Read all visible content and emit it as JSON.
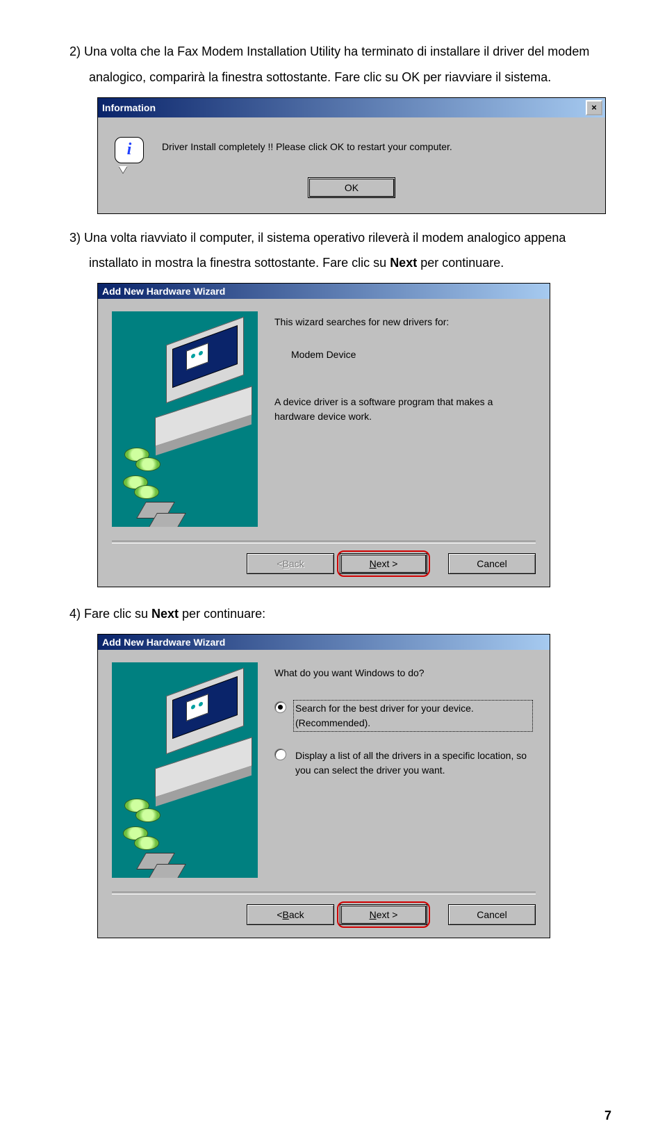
{
  "para2_line1": "2) Una volta che la Fax Modem Installation Utility ha terminato di installare il driver del modem",
  "para2_line2": "analogico, comparirà la finestra sottostante. Fare clic su OK per riavviare il sistema.",
  "info_dialog": {
    "title": "Information",
    "close": "×",
    "message": "Driver Install completely !! Please click OK to restart your computer.",
    "ok": "OK"
  },
  "para3_line1": "3) Una volta riavviato il computer, il sistema operativo rileverà il modem analogico appena",
  "para3_line2_a": "installato in mostra la finestra sottostante. Fare clic su ",
  "para3_line2_b": "Next",
  "para3_line2_c": " per continuare.",
  "wizard1": {
    "title": "Add New Hardware Wizard",
    "intro": "This wizard searches for new drivers for:",
    "device": "Modem Device",
    "desc": "A device driver is a software program that makes a hardware device work.",
    "back_prefix": "< ",
    "back_u": "B",
    "back_rest": "ack",
    "next_u": "N",
    "next_rest": "ext >",
    "cancel": "Cancel"
  },
  "para4_a": "4) Fare clic su ",
  "para4_b": "Next",
  "para4_c": " per continuare:",
  "wizard2": {
    "title": "Add New Hardware Wizard",
    "question": "What do you want Windows to do?",
    "opt1": "Search for the best driver for your device. (Recommended).",
    "opt2": "Display a list of all the drivers in a specific location, so you can select the driver you want.",
    "back_prefix": "< ",
    "back_u": "B",
    "back_rest": "ack",
    "next_u": "N",
    "next_rest": "ext >",
    "cancel": "Cancel"
  },
  "page_number": "7"
}
